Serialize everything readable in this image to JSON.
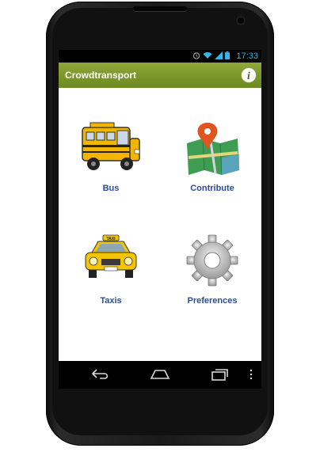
{
  "status_bar": {
    "time": "17:33",
    "icons": [
      "alarm-icon",
      "wifi-icon",
      "signal-icon",
      "battery-icon"
    ],
    "accent": "#33b5e5"
  },
  "action_bar": {
    "title": "Crowdtransport",
    "info_icon": "info-icon",
    "colors": [
      "#8fa737",
      "#6c8a1f"
    ]
  },
  "tiles": [
    {
      "label": "Bus",
      "icon": "school-bus-icon"
    },
    {
      "label": "Contribute",
      "icon": "map-pin-icon"
    },
    {
      "label": "Taxis",
      "icon": "taxi-icon"
    },
    {
      "label": "Preferences",
      "icon": "gear-icon"
    }
  ],
  "label_color": "#2a4f9a",
  "nav_bar": {
    "icons": [
      "back-icon",
      "home-icon",
      "recent-apps-icon",
      "overflow-menu-icon"
    ]
  }
}
